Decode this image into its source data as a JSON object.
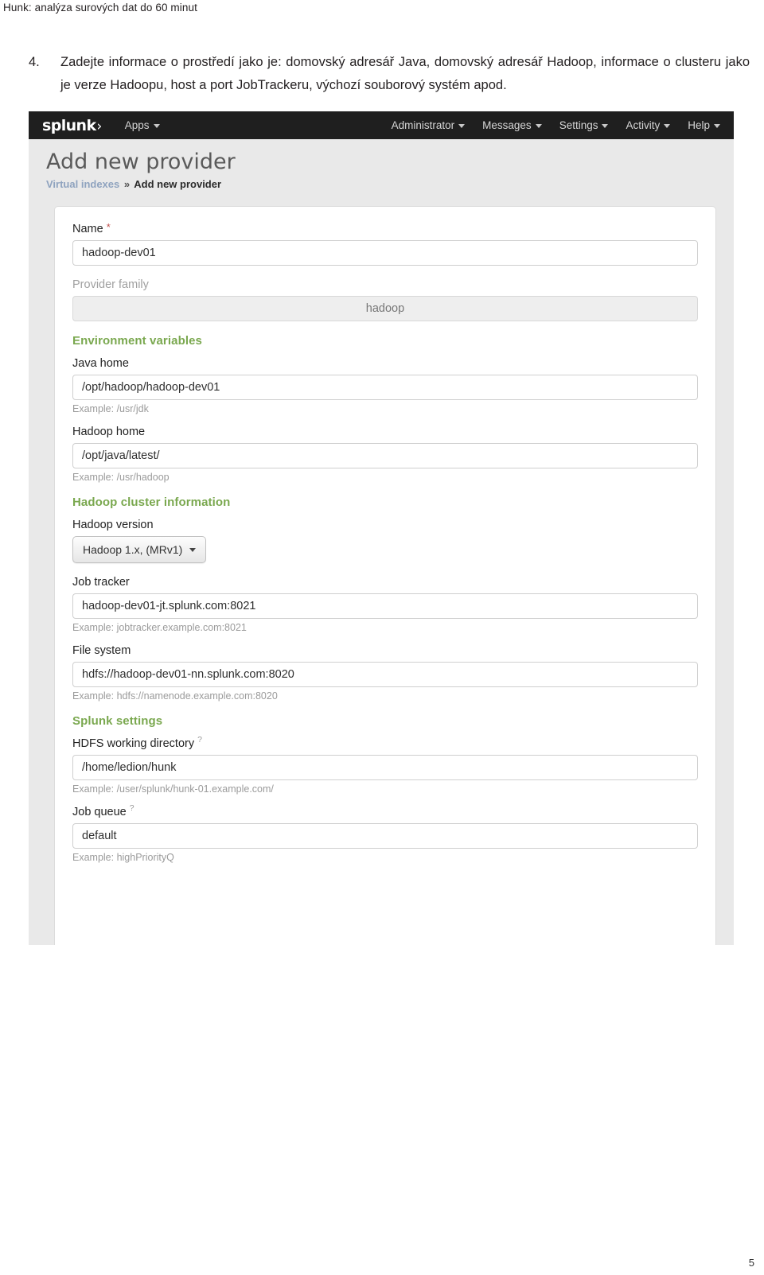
{
  "document": {
    "running_head": "Hunk: analýza surových dat do 60 minut",
    "page_number": "5",
    "item": {
      "number": "4.",
      "text": "Zadejte informace o prostředí jako je: domovský adresář Java, domovský adresář Hadoop, informace o clusteru jako je verze Hadoopu, host a port JobTrackeru, výchozí souborový systém apod."
    }
  },
  "screenshot": {
    "navbar": {
      "logo": "splunk",
      "logo_chevron": "›",
      "left_items": [
        {
          "label": "Apps",
          "caret": true
        }
      ],
      "right_items": [
        {
          "label": "Administrator",
          "caret": true
        },
        {
          "label": "Messages",
          "caret": true
        },
        {
          "label": "Settings",
          "caret": true
        },
        {
          "label": "Activity",
          "caret": true
        },
        {
          "label": "Help",
          "caret": true
        }
      ]
    },
    "page_title": "Add new provider",
    "breadcrumb": {
      "parent": "Virtual indexes",
      "separator": "»",
      "current": "Add new provider"
    },
    "form": {
      "name": {
        "label": "Name",
        "required_marker": "*",
        "value": "hadoop-dev01"
      },
      "provider_family": {
        "label": "Provider family",
        "value": "hadoop",
        "disabled": true
      },
      "sections": [
        {
          "title": "Environment variables"
        },
        {
          "title": "Hadoop cluster information"
        },
        {
          "title": "Splunk settings"
        }
      ],
      "java_home": {
        "label": "Java home",
        "value": "/opt/hadoop/hadoop-dev01",
        "hint": "Example: /usr/jdk"
      },
      "hadoop_home": {
        "label": "Hadoop home",
        "value": "/opt/java/latest/",
        "hint": "Example: /usr/hadoop"
      },
      "hadoop_version": {
        "label": "Hadoop version",
        "selected": "Hadoop 1.x, (MRv1)"
      },
      "job_tracker": {
        "label": "Job tracker",
        "value": "hadoop-dev01-jt.splunk.com:8021",
        "hint": "Example: jobtracker.example.com:8021"
      },
      "file_system": {
        "label": "File system",
        "value": "hdfs://hadoop-dev01-nn.splunk.com:8020",
        "hint": "Example: hdfs://namenode.example.com:8020"
      },
      "hdfs_working_directory": {
        "label": "HDFS working directory",
        "help_marker": "?",
        "value": "/home/ledion/hunk",
        "hint": "Example: /user/splunk/hunk-01.example.com/"
      },
      "job_queue": {
        "label": "Job queue",
        "help_marker": "?",
        "value": "default",
        "hint": "Example: highPriorityQ"
      }
    }
  },
  "colors": {
    "navbar_bg": "#1f1f1f",
    "section_green": "#7aa84f",
    "breadcrumb_link": "#8fa3bf",
    "required_star": "#c0504d",
    "page_canvas": "#e9e9e9"
  }
}
